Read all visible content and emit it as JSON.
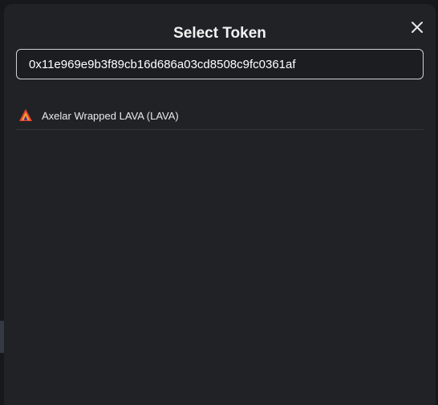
{
  "modal": {
    "title": "Select Token",
    "close_icon": "close-icon"
  },
  "search": {
    "value": "0x11e969e9b3f89cb16d686a03cd8508c9fc0361af"
  },
  "tokens": [
    {
      "name": "Axelar Wrapped LAVA (LAVA)",
      "icon": "lava-token-logo-icon"
    }
  ],
  "colors": {
    "modal_bg": "#212226",
    "input_border": "#cfd0d4",
    "text": "#eaeaea"
  }
}
